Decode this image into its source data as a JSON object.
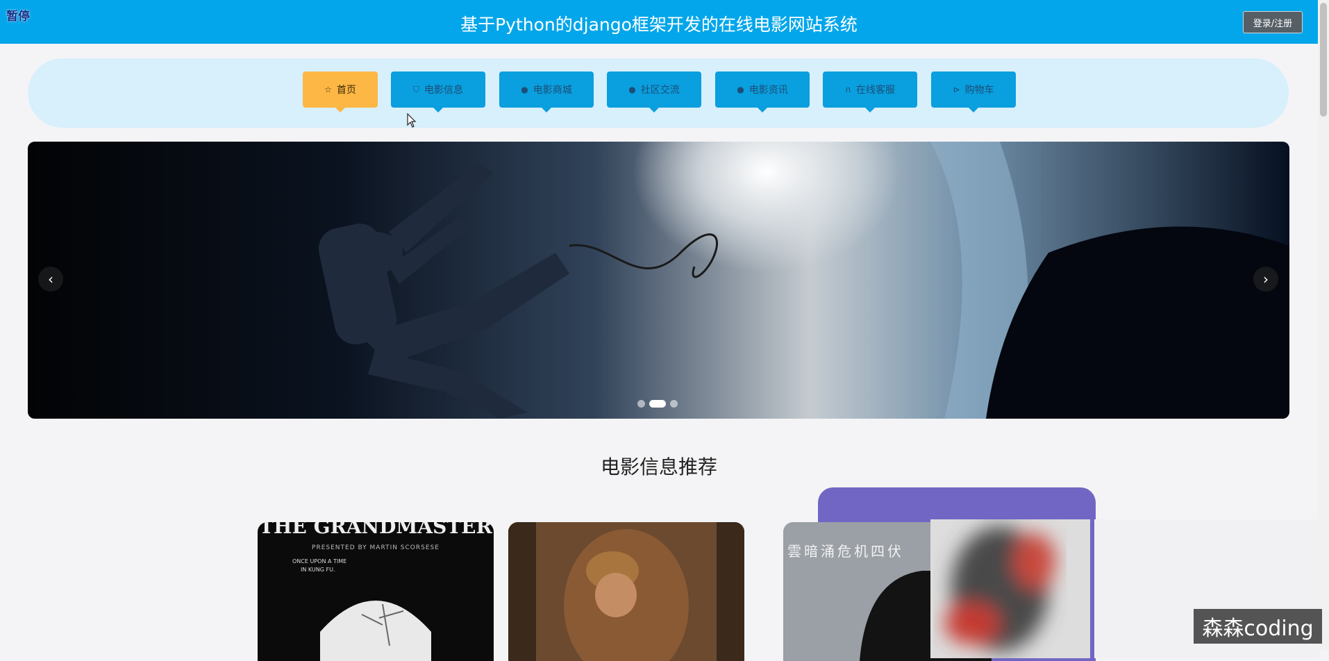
{
  "overlay": {
    "pause_label": "暂停"
  },
  "header": {
    "title": "基于Python的django框架开发的在线电影网站系统",
    "login_label": "登录/注册"
  },
  "nav": {
    "items": [
      {
        "label": "首页",
        "icon": "star-icon",
        "glyph": "☆",
        "active": true
      },
      {
        "label": "电影信息",
        "icon": "bag-icon",
        "glyph": "⛉",
        "active": false
      },
      {
        "label": "电影商城",
        "icon": "info-circle-icon",
        "glyph": "●",
        "active": false
      },
      {
        "label": "社区交流",
        "icon": "question-circle-icon",
        "glyph": "●",
        "active": false
      },
      {
        "label": "电影资讯",
        "icon": "info-circle-icon",
        "glyph": "●",
        "active": false
      },
      {
        "label": "在线客服",
        "icon": "headset-icon",
        "glyph": "∩",
        "active": false
      },
      {
        "label": "购物车",
        "icon": "cart-icon",
        "glyph": "⊳",
        "active": false
      }
    ]
  },
  "carousel": {
    "prev_glyph": "‹",
    "next_glyph": "›",
    "slides": 3,
    "active_slide": 2
  },
  "recommend": {
    "title": "电影信息推荐",
    "cards": [
      {
        "caption_top": "THE GRANDMASTER",
        "caption_sub": "PRESENTED BY MARTIN SCORSESE",
        "tagline_1": "ONCE UPON A TIME",
        "tagline_2": "IN KUNG FU."
      },
      {
        "caption_top": ""
      },
      {
        "caption_top": "雲暗涌危机四伏"
      }
    ]
  },
  "watermark": {
    "text": "森森coding"
  },
  "colors": {
    "header": "#03a6ea",
    "nav_item": "#0a9fde",
    "nav_active": "#fdb744",
    "nav_bg": "#d8effc",
    "accent_purple": "#7166c4"
  }
}
